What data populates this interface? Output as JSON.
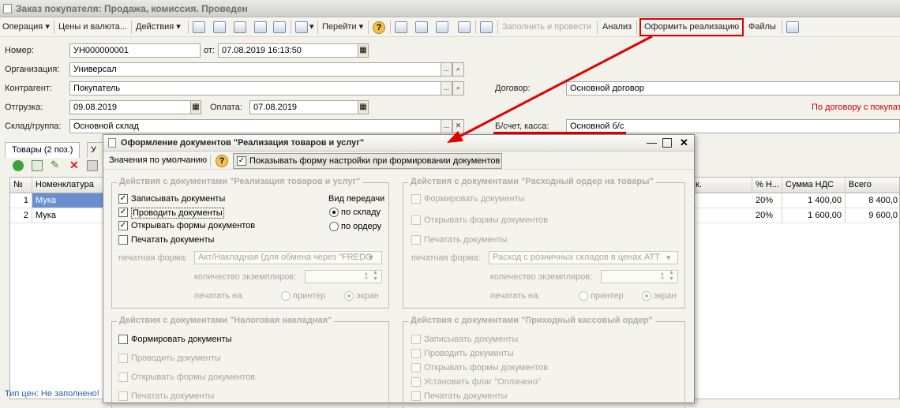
{
  "window": {
    "title": "Заказ покупателя: Продажа, комиссия. Проведен"
  },
  "toolbar": {
    "operation": "Операция",
    "prices": "Цены и валюта...",
    "actions": "Действия",
    "goto": "Перейти",
    "fill_post": "Заполнить и провести",
    "analysis": "Анализ",
    "make_sale": "Оформить реализацию",
    "files": "Файлы"
  },
  "form": {
    "number_label": "Номер:",
    "number_value": "УН000000001",
    "from_label": "от:",
    "date_value": "07.08.2019 16:13:50",
    "org_label": "Организация:",
    "org_value": "Универсал",
    "contractor_label": "Контрагент:",
    "contractor_value": "Покупатель",
    "contract_label": "Договор:",
    "contract_value": "Основной договор",
    "shipment_label": "Отгрузка:",
    "shipment_value": "09.08.2019",
    "payment_label": "Оплата:",
    "payment_value": "07.08.2019",
    "contract_note": "По договору с покупат",
    "warehouse_label": "Склад/группа:",
    "warehouse_value": "Основной склад",
    "account_label": "Б/счет, касса:",
    "account_value": "Основной б/с"
  },
  "tabs": {
    "goods": "Товары (2 поз.)",
    "second": "У"
  },
  "table": {
    "headers": {
      "n": "№",
      "item": "Номенклатура",
      "k": "к.",
      "vat_pct": "% Н...",
      "vat_sum": "Сумма НДС",
      "total": "Всего"
    },
    "rows": [
      {
        "n": "1",
        "item": "Мука",
        "vat_pct": "20%",
        "vat_sum": "1 400,00",
        "total": "8 400,0"
      },
      {
        "n": "2",
        "item": "Мука",
        "vat_pct": "20%",
        "vat_sum": "1 600,00",
        "total": "9 600,0"
      }
    ]
  },
  "footer": {
    "price_type": "Тип цен: Не заполнено!"
  },
  "dialog": {
    "title": "Оформление документов \"Реализация товаров и услуг\"",
    "defaults_btn": "Значения по умолчанию",
    "show_form": "Показывать форму настройки при формировании документов",
    "g1": {
      "title": "Действия с документами \"Реализация товаров и услуг\"",
      "write": "Записывать документы",
      "post": "Проводить документы",
      "open": "Открывать формы документов",
      "print": "Печатать документы",
      "transfer_label": "Вид передачи",
      "by_warehouse": "по складу",
      "by_order": "по ордеру",
      "print_form_label": "печатная форма:",
      "print_form_value": "Акт/Накладная (для обмена через \"FREDO",
      "copies_label": "количество экземпляров:",
      "copies_value": "1",
      "print_on_label": "печатать на:",
      "printer": "принтер",
      "screen": "экран"
    },
    "g2": {
      "title": "Действия с документами \"Расходный ордер на товары\"",
      "make": "Формировать документы",
      "open": "Открывать формы документов",
      "print": "Печатать документы",
      "print_form_label": "печатная форма:",
      "print_form_value": "Расход с розничных складов в ценах АТТ",
      "copies_label": "количество экземпляров:",
      "copies_value": "1",
      "print_on_label": "печатать на:",
      "printer": "принтер",
      "screen": "экран"
    },
    "g3": {
      "title": "Действия с документами \"Налоговая накладная\"",
      "make": "Формировать документы",
      "post": "Проводить документы",
      "open": "Открывать формы документов",
      "print": "Печатать документы"
    },
    "g4": {
      "title": "Действия с документами \"Приходный кассовый ордер\"",
      "write": "Записывать документы",
      "post": "Проводить документы",
      "open": "Открывать формы документов",
      "paid": "Установить флаг \"Оплачено\"",
      "print": "Печатать документы"
    }
  },
  "colors": {
    "highlight": "#e00000",
    "selection": "#6a8fd0",
    "note": "#cc0000",
    "link": "#2a5db0"
  }
}
